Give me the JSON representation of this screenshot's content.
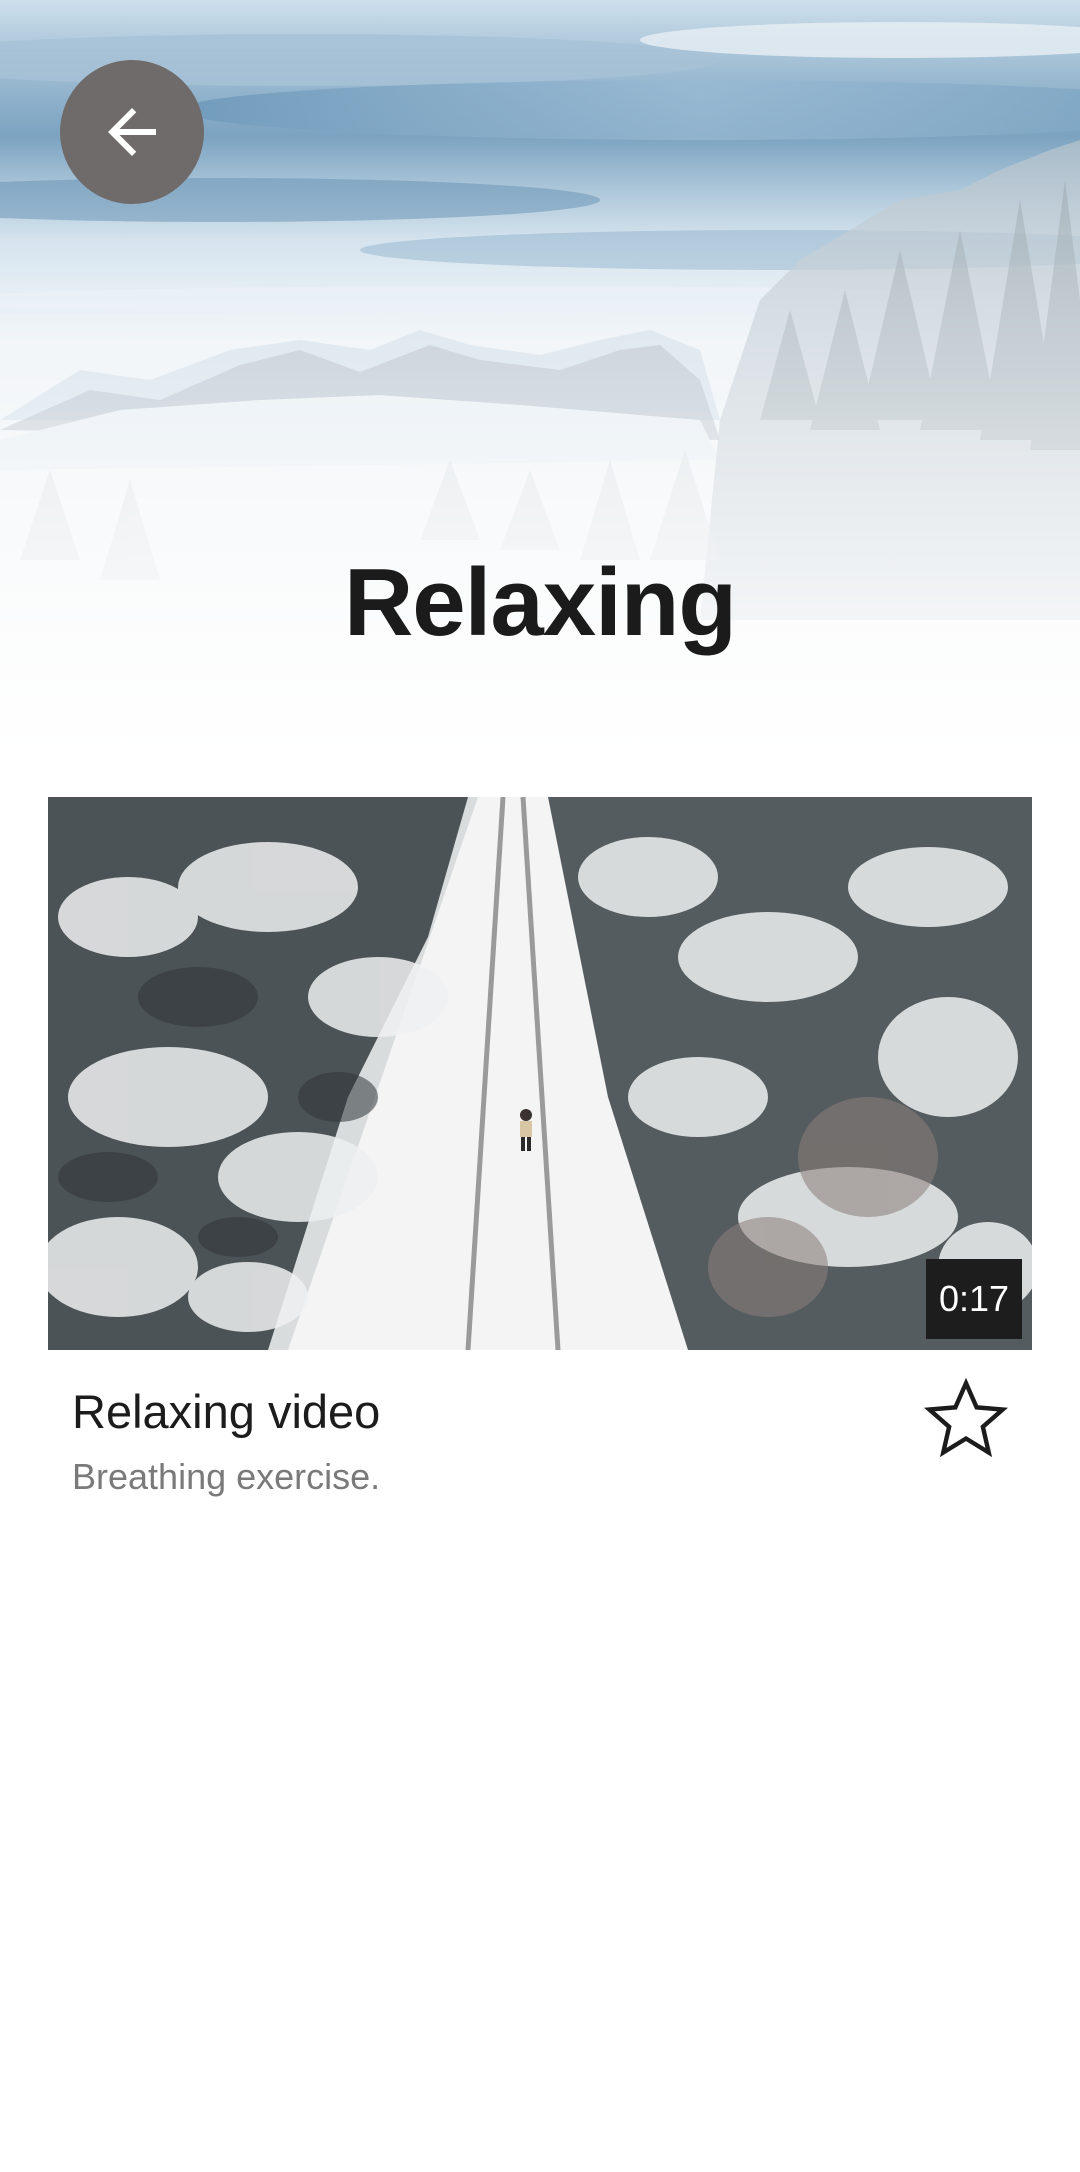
{
  "header": {
    "title": "Relaxing",
    "back_icon": "arrow-left-icon"
  },
  "video": {
    "title": "Relaxing video",
    "subtitle": "Breathing exercise.",
    "duration": "0:17",
    "favorite_icon": "star-outline-icon"
  },
  "colors": {
    "back_button_bg": "#6f6b6a",
    "duration_badge_bg": "#1d1d1d",
    "title_text": "#1b1b1b",
    "subtitle_text": "#7a7a7a"
  }
}
